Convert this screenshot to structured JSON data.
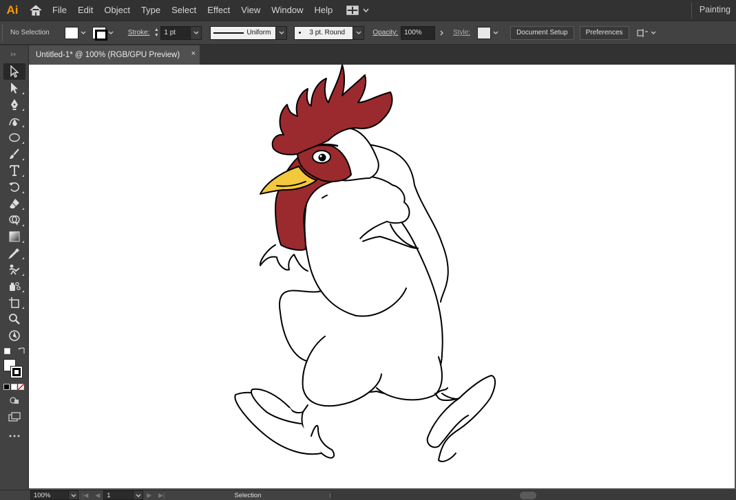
{
  "app": {
    "logo": "Ai",
    "workspace": "Painting"
  },
  "menu": [
    "File",
    "Edit",
    "Object",
    "Type",
    "Select",
    "Effect",
    "View",
    "Window",
    "Help"
  ],
  "control_bar": {
    "selection_label": "No Selection",
    "stroke_label": "Stroke:",
    "stroke_weight": "1 pt",
    "variable_width_profile": "Uniform",
    "brush": "3 pt. Round",
    "opacity_label": "Opacity:",
    "opacity_value": "100%",
    "style_label": "Style:",
    "document_setup_button": "Document Setup",
    "preferences_button": "Preferences"
  },
  "document_tab": {
    "title": "Untitled-1* @ 100% (RGB/GPU Preview)",
    "close": "×"
  },
  "status_bar": {
    "zoom": "100%",
    "artboard_number": "1",
    "current_tool": "Selection"
  },
  "colors": {
    "comb": "#9b2a2e",
    "wattle": "#9b2a2e",
    "beak": "#f3c83c",
    "body": "#ffffff",
    "outline": "#000000",
    "accent": "#ff9a00"
  },
  "tools": [
    "selection-tool-icon",
    "direct-selection-tool-icon",
    "pen-tool-icon",
    "curvature-tool-icon",
    "ellipse-tool-icon",
    "paintbrush-tool-icon",
    "type-tool-icon",
    "rotate-tool-icon",
    "eraser-tool-icon",
    "shape-builder-tool-icon",
    "gradient-tool-icon",
    "eyedropper-tool-icon",
    "puppet-warp-tool-icon",
    "symbol-sprayer-tool-icon",
    "artboard-tool-icon",
    "zoom-tool-icon",
    "hand-tool-icon"
  ]
}
